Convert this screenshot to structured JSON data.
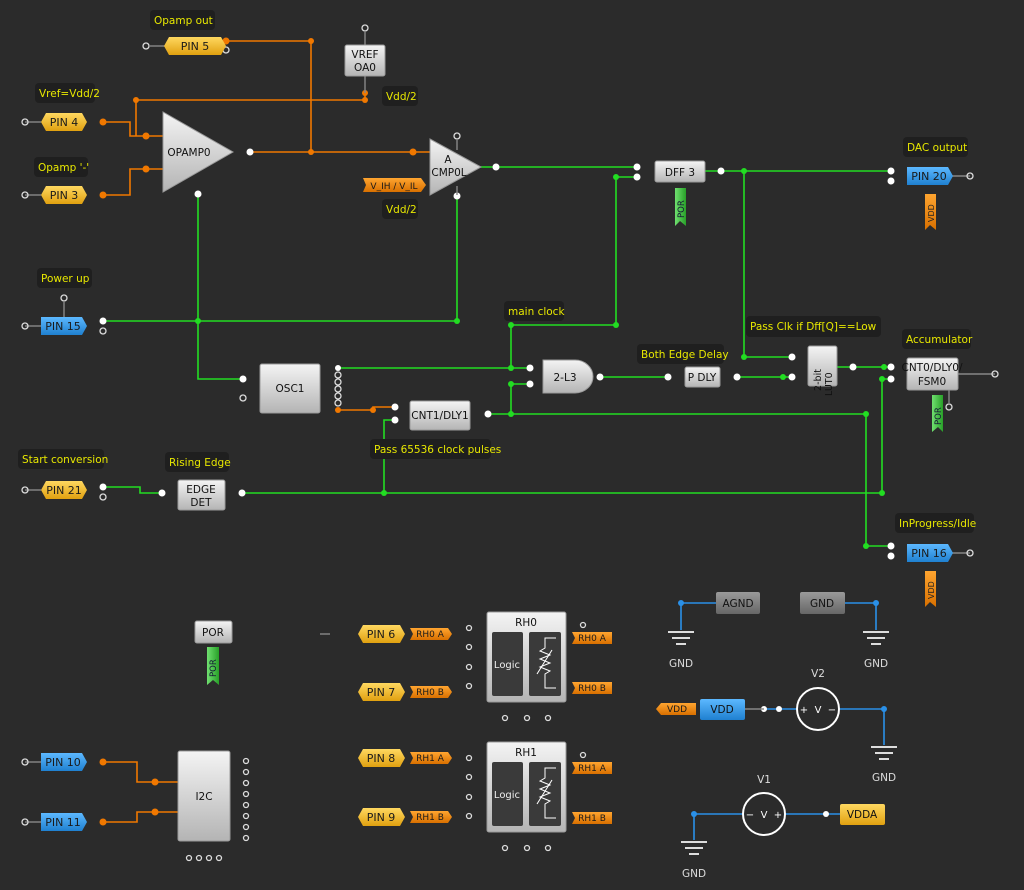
{
  "colors": {
    "background": "#2b2b2b",
    "wire_analog": "#f07800",
    "wire_digital": "#22dd22",
    "wire_power": "#2a90e8",
    "pin_io": "#f0b820",
    "pin_input": "#3aa0e8",
    "label_text": "#e8e800",
    "por_tag": "#3cc83c"
  },
  "labels": {
    "opamp_out": "Opamp out",
    "vref": "Vref=Vdd/2",
    "opamp_minus": "Opamp '-'",
    "power_up": "Power up",
    "start_conv": "Start conversion",
    "dac_output": "DAC output",
    "inprogress": "InProgress/Idle",
    "vdd2_a": "Vdd/2",
    "vdd2_b": "Vdd/2",
    "main_clock": "main clock",
    "both_edge": "Both Edge Delay",
    "pass_clk": "Pass Clk if Dff[Q]==Low",
    "accumulator": "Accumulator",
    "rising_edge": "Rising Edge",
    "pass_pulses": "Pass 65536 clock pulses"
  },
  "pins": {
    "p5": "PIN 5",
    "p4": "PIN 4",
    "p3": "PIN 3",
    "p15": "PIN 15",
    "p21": "PIN 21",
    "p20": "PIN 20",
    "p16": "PIN 16",
    "p6": "PIN 6",
    "p7": "PIN 7",
    "p8": "PIN 8",
    "p9": "PIN 9",
    "p10": "PIN 10",
    "p11": "PIN 11"
  },
  "blocks": {
    "vref_1": "VREF",
    "vref_2": "OA0",
    "opamp": "OPAMP0",
    "cmp_1": "A",
    "cmp_2": "CMP0L",
    "vih": "V_IH / V_IL",
    "dff": "DFF 3",
    "osc": "OSC1",
    "cnt1": "CNT1/DLY1",
    "and": "2-L3",
    "pdly": "P DLY",
    "lut_1": "2-bit",
    "lut_2": "LUT0",
    "cnt0_1": "CNT0/DLY0/",
    "cnt0_2": "FSM0",
    "edge_1": "EDGE",
    "edge_2": "DET",
    "por": "POR",
    "i2c": "I2C",
    "rh0": "RH0",
    "rh1": "RH1",
    "logic": "Logic",
    "agnd": "AGND",
    "gnd_block": "GND",
    "vdd_block": "VDD",
    "vdda": "VDDA",
    "v1": "V1",
    "v2": "V2",
    "v_sym": "V"
  },
  "tags": {
    "por": "POR",
    "vdd": "VDD",
    "rh0a": "RH0 A",
    "rh0b": "RH0 B",
    "rh1a": "RH1 A",
    "rh1b": "RH1 B"
  },
  "ground_label": "GND"
}
